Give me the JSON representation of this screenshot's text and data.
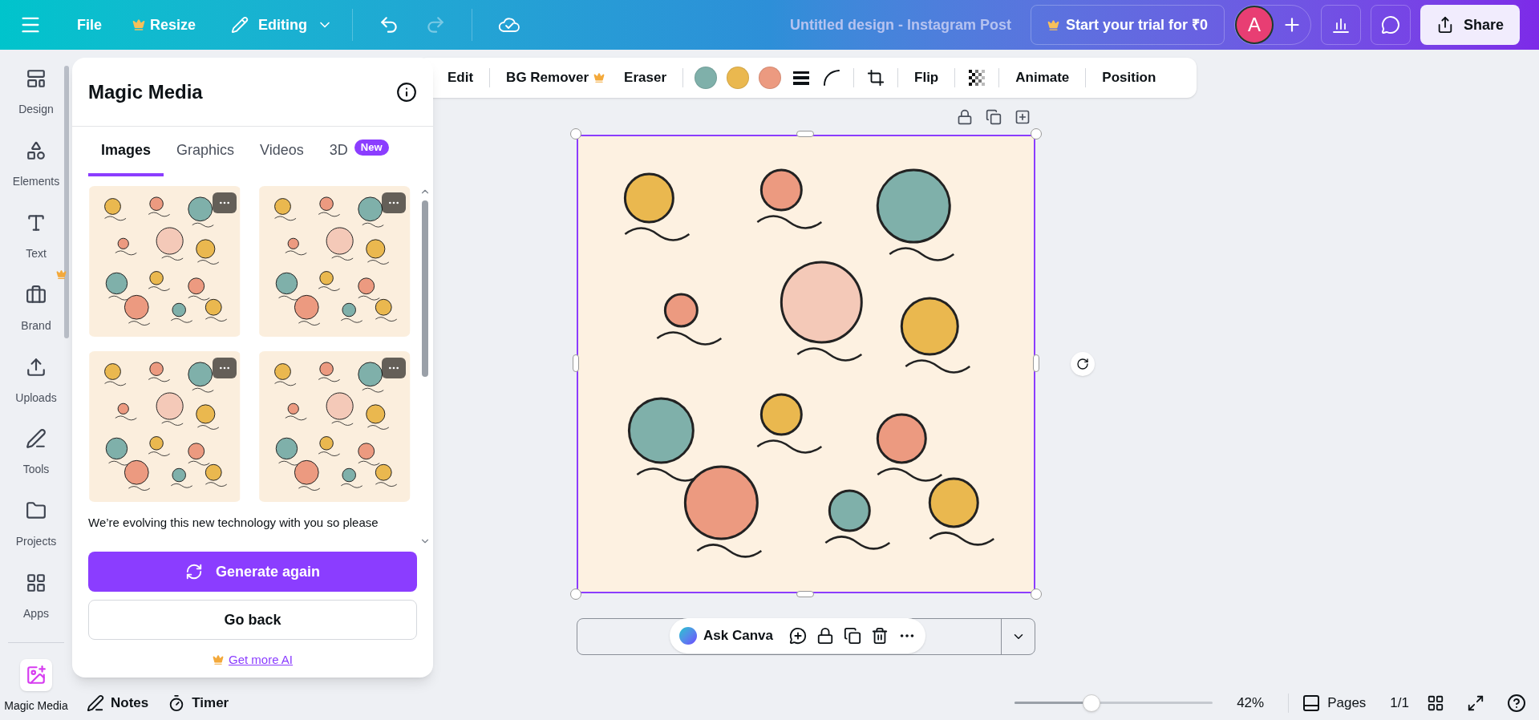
{
  "top_bar": {
    "menu": {
      "label": "File"
    },
    "resize": {
      "label": "Resize",
      "premium": true
    },
    "mode": {
      "label": "Editing"
    },
    "undo": {
      "disabled": false
    },
    "redo": {
      "disabled": true
    },
    "title": "Untitled design - Instagram Post",
    "trial_button": "Start your trial for ₹0",
    "avatar": "A",
    "share": "Share"
  },
  "sidebar": {
    "items": [
      {
        "label": "Design",
        "selected": false,
        "premium": false
      },
      {
        "label": "Elements",
        "selected": false,
        "premium": false
      },
      {
        "label": "Text",
        "selected": false,
        "premium": false
      },
      {
        "label": "Brand",
        "selected": false,
        "premium": true
      },
      {
        "label": "Uploads",
        "selected": false,
        "premium": false
      },
      {
        "label": "Tools",
        "selected": false,
        "premium": false
      },
      {
        "label": "Projects",
        "selected": false,
        "premium": false
      },
      {
        "label": "Apps",
        "selected": false,
        "premium": false
      },
      {
        "label": "Magic Media",
        "selected": true,
        "premium": false
      }
    ]
  },
  "panel": {
    "title": "Magic Media",
    "tabs": [
      {
        "label": "Images",
        "selected": true
      },
      {
        "label": "Graphics",
        "selected": false
      },
      {
        "label": "Videos",
        "selected": false
      },
      {
        "label": "3D",
        "selected": false,
        "badge": "New"
      }
    ],
    "notice": "We’re evolving this new technology with you so please",
    "generate_button": "Generate again",
    "back_button": "Go back",
    "upsell_link": "Get more AI"
  },
  "toolbar": {
    "items": [
      {
        "kind": "text",
        "label": "Edit",
        "premium": false
      },
      {
        "kind": "text",
        "label": "BG Remover",
        "premium": true
      },
      {
        "kind": "text",
        "label": "Eraser",
        "premium": false
      },
      {
        "kind": "swatch",
        "color": "#7fb0aa"
      },
      {
        "kind": "swatch",
        "color": "#eab84f"
      },
      {
        "kind": "swatch",
        "color": "#ec9a80"
      },
      {
        "kind": "stroke"
      },
      {
        "kind": "corner"
      },
      {
        "kind": "crop"
      },
      {
        "kind": "text",
        "label": "Flip",
        "premium": false
      },
      {
        "kind": "transparency"
      },
      {
        "kind": "text",
        "label": "Animate",
        "premium": false
      },
      {
        "kind": "text",
        "label": "Position",
        "premium": false
      }
    ]
  },
  "canvas": {
    "ask_button": "Ask Canva"
  },
  "bottom_bar": {
    "notes": "Notes",
    "timer": "Timer",
    "zoom": {
      "level": 0.39,
      "reading": "42%"
    },
    "pages": "Pages",
    "page_count": "1/1"
  }
}
